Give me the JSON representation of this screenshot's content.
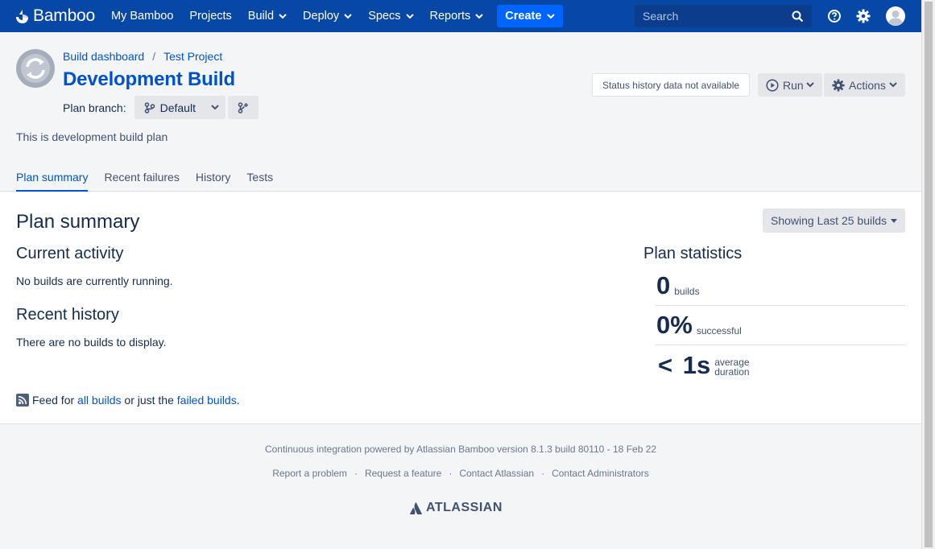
{
  "nav": {
    "logo": "Bamboo",
    "items": [
      {
        "label": "My Bamboo",
        "dropdown": false
      },
      {
        "label": "Projects",
        "dropdown": false
      },
      {
        "label": "Build",
        "dropdown": true
      },
      {
        "label": "Deploy",
        "dropdown": true
      },
      {
        "label": "Specs",
        "dropdown": true
      },
      {
        "label": "Reports",
        "dropdown": true
      }
    ],
    "create_label": "Create",
    "search_placeholder": "Search"
  },
  "header": {
    "breadcrumb": [
      "Build dashboard",
      "Test Project"
    ],
    "title": "Development Build",
    "branch_label": "Plan branch:",
    "branch_value": "Default",
    "description": "This is development build plan",
    "status_text": "Status history data not available",
    "run_label": "Run",
    "actions_label": "Actions",
    "tabs": [
      "Plan summary",
      "Recent failures",
      "History",
      "Tests"
    ],
    "active_tab": 0
  },
  "main": {
    "heading": "Plan summary",
    "showing_label": "Showing Last 25 builds",
    "current_activity_title": "Current activity",
    "current_activity_text": "No builds are currently running.",
    "recent_history_title": "Recent history",
    "recent_history_text": "There are no builds to display.",
    "stats_title": "Plan statistics",
    "stats": {
      "builds_value": "0",
      "builds_label": "builds",
      "success_value": "0%",
      "success_label": "successful",
      "duration_value": "< 1s",
      "duration_label_1": "average",
      "duration_label_2": "duration"
    },
    "feed": {
      "prefix": "Feed for",
      "all_link": "all builds",
      "middle": "or just the",
      "failed_link": "failed builds",
      "suffix": "."
    }
  },
  "footer": {
    "powered": "Continuous integration powered by Atlassian Bamboo version 8.1.3 build 80110 - 18 Feb 22",
    "links": [
      "Report a problem",
      "Request a feature",
      "Contact Atlassian",
      "Contact Administrators"
    ],
    "logo_text": "ATLASSIAN"
  },
  "colors": {
    "nav_bg": "#0747a6",
    "link": "#0052cc",
    "create_bg": "#0065ff"
  }
}
